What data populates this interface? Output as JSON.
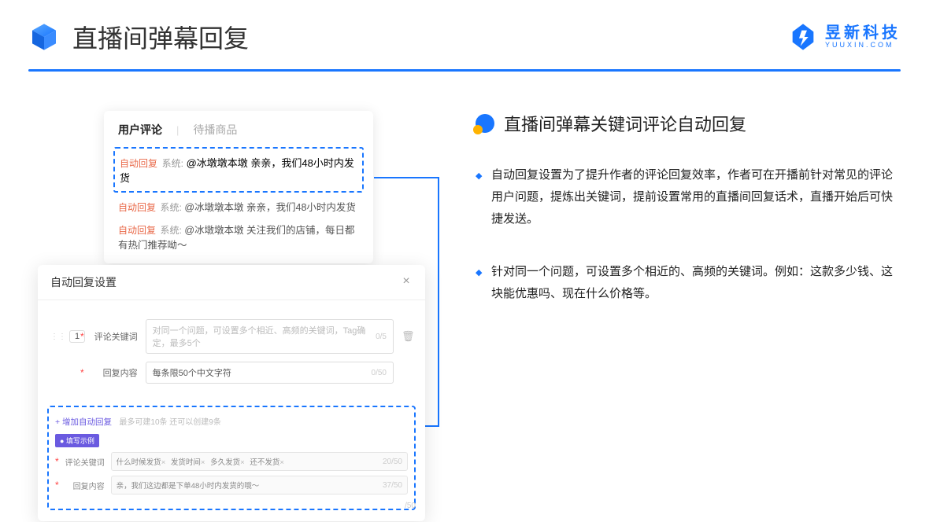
{
  "header": {
    "title": "直播间弹幕回复"
  },
  "logo": {
    "cn": "昱新科技",
    "en": "YUUXIN.COM"
  },
  "comments": {
    "tabs": {
      "active": "用户评论",
      "inactive": "待播商品",
      "sep": "|"
    },
    "items": [
      {
        "badge": "自动回复",
        "sys": "系统:",
        "text": "@冰墩墩本墩 亲亲，我们48小时内发货"
      },
      {
        "badge": "自动回复",
        "sys": "系统:",
        "text": "@冰墩墩本墩 亲亲，我们48小时内发货"
      },
      {
        "badge": "自动回复",
        "sys": "系统:",
        "text": "@冰墩墩本墩 关注我们的店铺，每日都有热门推荐呦～"
      }
    ]
  },
  "settings": {
    "title": "自动回复设置",
    "index": "1",
    "rows": [
      {
        "label": "评论关键词",
        "placeholder": "对同一个问题，可设置多个相近、高频的关键词，Tag确定，最多5个",
        "counter": "0/5"
      },
      {
        "label": "回复内容",
        "placeholder": "每条限50个中文字符",
        "counter": "0/50"
      }
    ],
    "add_link": "+ 增加自动回复",
    "add_hint": "最多可建10条 还可以创建9条",
    "example_tag": "● 填写示例",
    "ex_rows": [
      {
        "label": "评论关键词",
        "chips": [
          "什么时候发货",
          "发货时间",
          "多久发货",
          "还不发货"
        ],
        "counter": "20/50"
      },
      {
        "label": "回复内容",
        "value": "亲，我们这边都是下单48小时内发货的哦～",
        "counter": "37/50"
      }
    ],
    "extra_counter": "/50"
  },
  "right": {
    "section_title": "直播间弹幕关键词评论自动回复",
    "bullets": [
      "自动回复设置为了提升作者的评论回复效率，作者可在开播前针对常见的评论用户问题，提炼出关键词，提前设置常用的直播间回复话术，直播开始后可快捷发送。",
      "针对同一个问题，可设置多个相近的、高频的关键词。例如：这款多少钱、这块能优惠吗、现在什么价格等。"
    ]
  }
}
